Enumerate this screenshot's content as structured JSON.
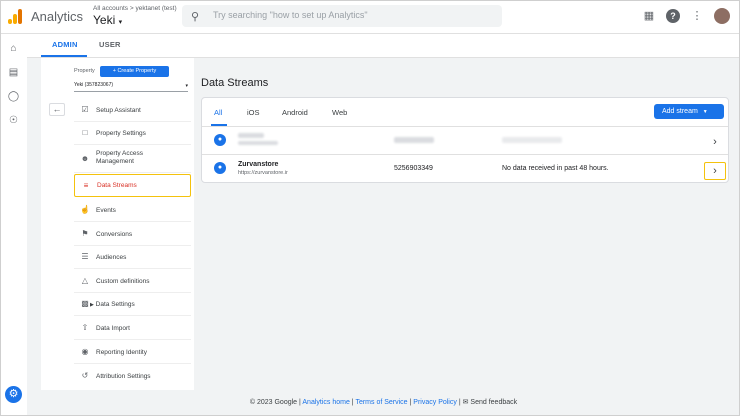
{
  "header": {
    "app_title": "Analytics",
    "account_path": "All accounts > yektanet (test)",
    "account_name": "Yeki",
    "search_placeholder": "Try searching \"how to set up Analytics\"",
    "brand_color": "#f9ab00"
  },
  "admin_tabs": [
    {
      "label": "ADMIN",
      "active": true
    },
    {
      "label": "USER",
      "active": false
    }
  ],
  "property": {
    "label": "Property",
    "create_label": "+ Create Property",
    "selected": "Yeki (357823067)"
  },
  "nav": [
    {
      "label": "Setup Assistant",
      "icon": "checklist-icon"
    },
    {
      "label": "Property Settings",
      "icon": "settings-page-icon"
    },
    {
      "label": "Property Access Management",
      "icon": "people-icon"
    },
    {
      "label": "Data Streams",
      "icon": "streams-icon",
      "selected": true
    },
    {
      "label": "Events",
      "icon": "touch-icon"
    },
    {
      "label": "Conversions",
      "icon": "flag-icon"
    },
    {
      "label": "Audiences",
      "icon": "audience-icon"
    },
    {
      "label": "Custom definitions",
      "icon": "shapes-icon"
    },
    {
      "label": "Data Settings",
      "icon": "database-icon"
    },
    {
      "label": "Data Import",
      "icon": "upload-icon"
    },
    {
      "label": "Reporting Identity",
      "icon": "identity-icon"
    },
    {
      "label": "Attribution Settings",
      "icon": "attribution-icon"
    }
  ],
  "main": {
    "title": "Data Streams",
    "filter_tabs": [
      {
        "label": "All",
        "active": true
      },
      {
        "label": "iOS",
        "active": false
      },
      {
        "label": "Android",
        "active": false
      },
      {
        "label": "Web",
        "active": false
      }
    ],
    "add_stream_label": "Add stream",
    "streams": [
      {
        "name": "Zurvanstore",
        "url": "https://zurvanstore.ir",
        "id": "5256903349",
        "status": "No data received in past 48 hours."
      }
    ]
  },
  "footer": {
    "copyright": "© 2023 Google |",
    "analytics_home": "Analytics home",
    "terms": "Terms of Service",
    "privacy": "Privacy Policy",
    "feedback": "Send feedback"
  }
}
